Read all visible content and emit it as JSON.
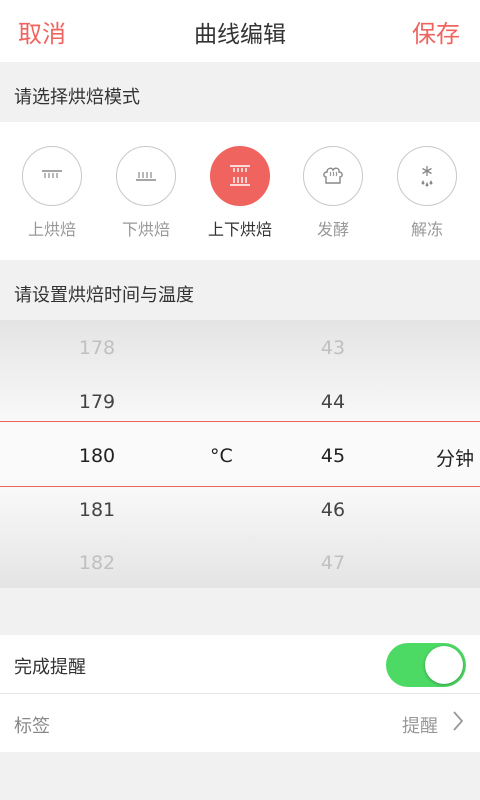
{
  "header": {
    "cancel": "取消",
    "title": "曲线编辑",
    "save": "保存"
  },
  "mode_section": {
    "label": "请选择烘焙模式"
  },
  "modes": [
    {
      "label": "上烘焙",
      "icon": "top-heat-icon",
      "active": false
    },
    {
      "label": "下烘焙",
      "icon": "bottom-heat-icon",
      "active": false
    },
    {
      "label": "上下烘焙",
      "icon": "top-bottom-heat-icon",
      "active": true
    },
    {
      "label": "发酵",
      "icon": "ferment-icon",
      "active": false
    },
    {
      "label": "解冻",
      "icon": "defrost-icon",
      "active": false
    }
  ],
  "time_section": {
    "label": "请设置烘焙时间与温度"
  },
  "picker": {
    "temps": [
      "178",
      "179",
      "180",
      "181",
      "182"
    ],
    "temp_unit": "°C",
    "minutes": [
      "43",
      "44",
      "45",
      "46",
      "47"
    ],
    "minute_unit": "分钟"
  },
  "reminder": {
    "label": "完成提醒",
    "enabled": true
  },
  "tag": {
    "label": "标签",
    "value": "提醒"
  },
  "colors": {
    "accent": "#f0645f",
    "toggle_on": "#4cd964"
  }
}
